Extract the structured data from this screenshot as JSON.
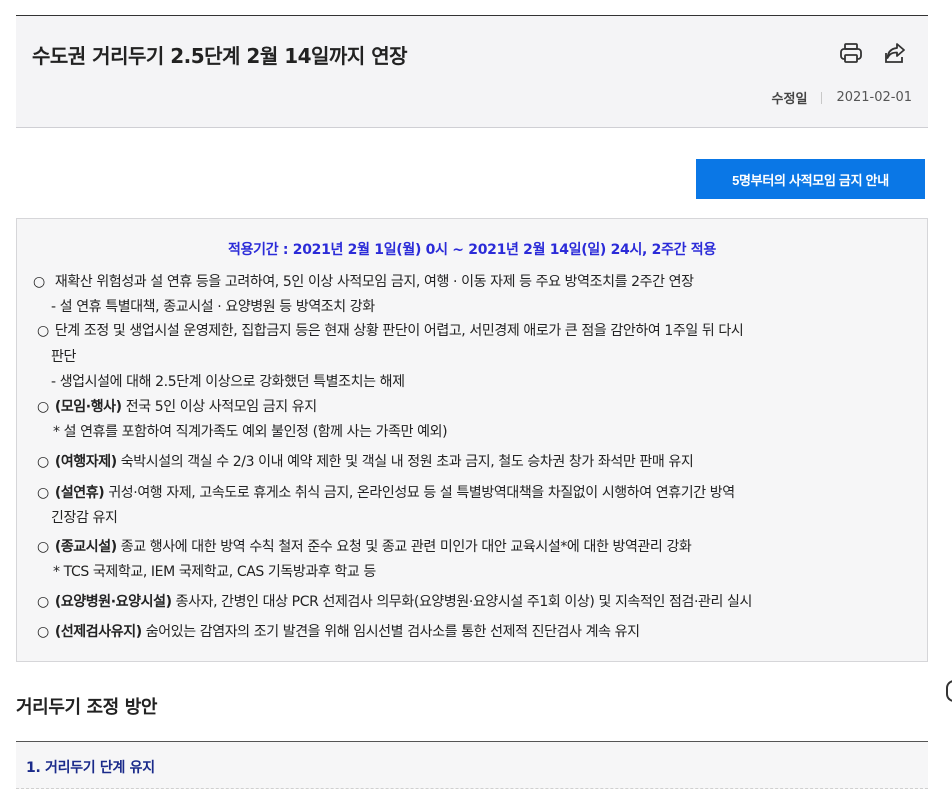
{
  "header": {
    "title": "수도권 거리두기 2.5단계 2월 14일까지 연장",
    "print_icon": "print-icon",
    "share_icon": "share-icon",
    "modified_label": "수정일",
    "modified_date": "2021-02-01"
  },
  "notice_button": {
    "label": "5명부터의 사적모임 금지 안내"
  },
  "box": {
    "period": "적용기간 : 2021년 2월 1일(월) 0시 ~ 2021년 2월 14일(일) 24시, 2주간 적용",
    "lines": [
      {
        "bullet": "○",
        "bold": "",
        "text": " 재확산 위험성과 설 연휴 등을 고려하여, 5인 이상 사적모임 금지, 여행 · 이동 자제 등 주요 방역조치를 2주간 연장"
      },
      {
        "bullet": "",
        "bold": "",
        "text": "- 설 연휴 특별대책, 종교시설 · 요양병원 등 방역조치 강화"
      },
      {
        "bullet": "○",
        "bold": "",
        "text": "단계 조정 및 생업시설 운영제한, 집합금지 등은 현재 상황 판단이 어렵고, 서민경제 애로가 큰 점을 감안하여 1주일 뒤 다시"
      },
      {
        "bullet": "",
        "bold": "",
        "text": "판단"
      },
      {
        "bullet": "",
        "bold": "",
        "text": "- 생업시설에 대해 2.5단계 이상으로 강화했던 특별조치는 해제"
      },
      {
        "bullet": "○",
        "bold": "(모임·행사)",
        "text": " 전국 5인 이상 사적모임 금지 유지"
      },
      {
        "bullet": "",
        "bold": "",
        "text": "* 설 연휴를 포함하여 직계가족도 예외 불인정 (함께 사는 가족만 예외)"
      },
      {
        "bullet": "○",
        "bold": "(여행자제)",
        "text": " 숙박시설의 객실 수 2/3 이내 예약 제한 및 객실 내 정원 초과 금지, 철도 승차권 창가 좌석만 판매 유지"
      },
      {
        "bullet": "○",
        "bold": "(설연휴)",
        "text": " 귀성·여행 자제, 고속도로 휴게소 취식 금지, 온라인성묘 등 설 특별방역대책을 차질없이 시행하여 연휴기간 방역"
      },
      {
        "bullet": "",
        "bold": "",
        "text": "긴장감 유지"
      },
      {
        "bullet": "○",
        "bold": "(종교시설)",
        "text": " 종교 행사에 대한 방역 수칙 철저 준수 요청 및 종교 관련 미인가 대안 교육시설*에 대한 방역관리 강화"
      },
      {
        "bullet": "",
        "bold": "",
        "text": "* TCS 국제학교, IEM 국제학교, CAS 기독방과후 학교 등"
      },
      {
        "bullet": "○",
        "bold": "(요양병원·요양시설)",
        "text": " 종사자, 간병인 대상 PCR 선제검사 의무화(요양병원·요양시설 주1회 이상) 및 지속적인 점검·관리 실시"
      },
      {
        "bullet": "○",
        "bold": "(선제검사유지)",
        "text": " 숨어있는 감염자의 조기 발견을 위해 임시선별 검사소를 통한 선제적 진단검사 계속 유지"
      }
    ]
  },
  "section": {
    "title": "거리두기 조정 방안",
    "subtitle": "1. 거리두기 단계 유지"
  }
}
